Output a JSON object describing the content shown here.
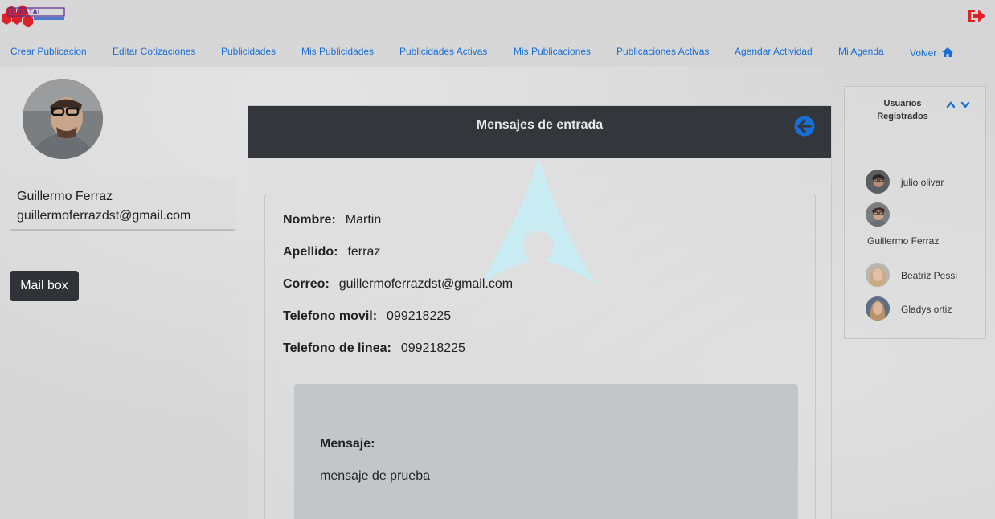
{
  "header": {
    "logo_text": "CRISTAL",
    "nav": [
      {
        "label": "Crear Publicacion"
      },
      {
        "label": "Editar Cotizaciones"
      },
      {
        "label": "Publicidades"
      },
      {
        "label": "Mis Publicidades"
      },
      {
        "label": "Publicidades Activas"
      },
      {
        "label": "Mis Publicaciones"
      },
      {
        "label": "Publicaciones Activas"
      },
      {
        "label": "Agendar Actividad"
      },
      {
        "label": "Mi Agenda"
      },
      {
        "label": "Volver"
      }
    ],
    "icons": {
      "logout": "sign-out-icon",
      "home": "home-icon"
    },
    "colors": {
      "link": "#1a6fd6",
      "logout": "#e0202a"
    }
  },
  "profile": {
    "name": "Guillermo Ferraz",
    "email": "guillermoferrazdst@gmail.com",
    "mailbox_label": "Mail box"
  },
  "inbox": {
    "title": "Mensajes de entrada",
    "fields": [
      {
        "label": "Nombre:",
        "value": "Martin"
      },
      {
        "label": "Apellido:",
        "value": "ferraz"
      },
      {
        "label": "Correo:",
        "value": "guillermoferrazdst@gmail.com"
      },
      {
        "label": "Telefono movil:",
        "value": "099218225"
      },
      {
        "label": "Telefono de linea:",
        "value": "099218225"
      }
    ],
    "message_label": "Mensaje:",
    "message_text": "mensaje de prueba",
    "colors": {
      "header_bg": "#33373b",
      "back_icon": "#1a6fd6"
    }
  },
  "users": {
    "title": "Usuarios Registrados",
    "list": [
      {
        "name": "julio olivar"
      },
      {
        "name": "Guillermo Ferraz"
      },
      {
        "name": "Beatriz Pessi"
      },
      {
        "name": "Gladys ortiz"
      }
    ]
  }
}
